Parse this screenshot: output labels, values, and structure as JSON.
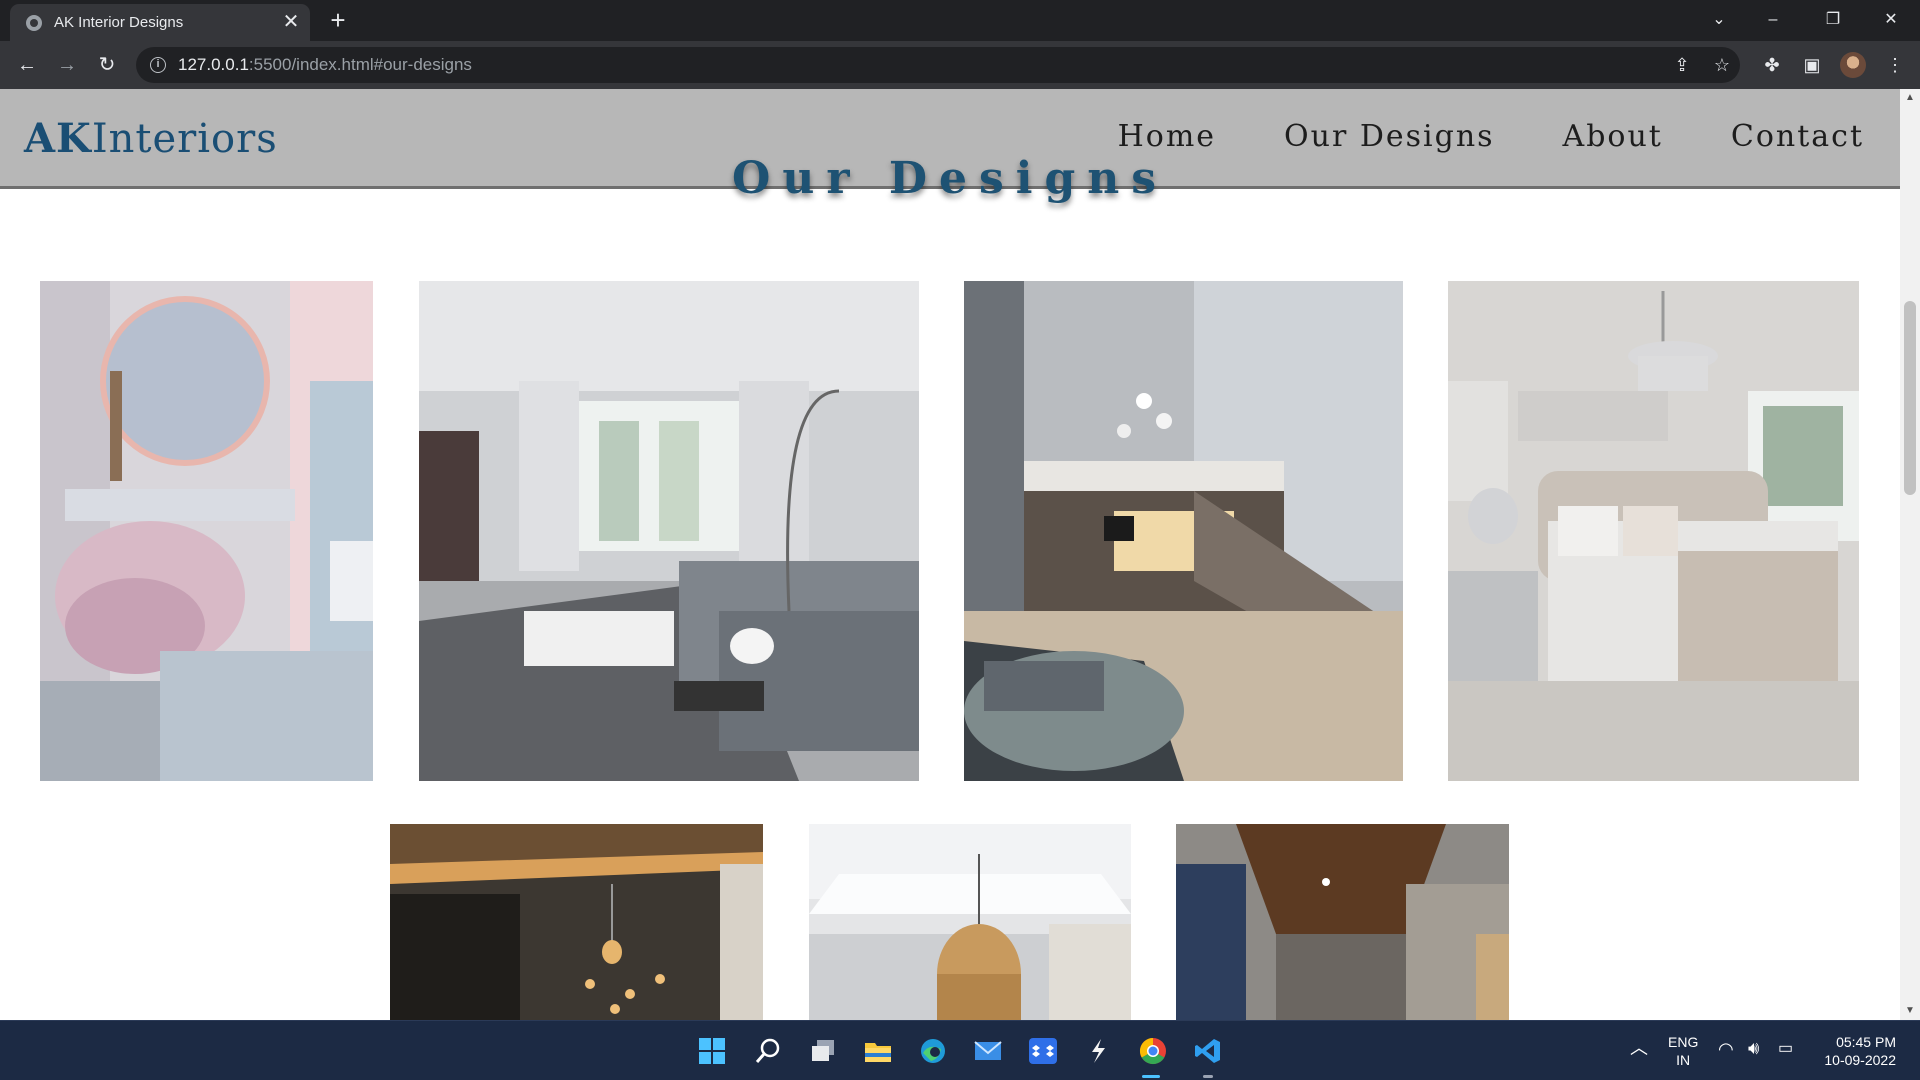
{
  "browser": {
    "tab_title": "AK Interior Designs",
    "tab_close": "✕",
    "new_tab": "+",
    "url_host": "127.0.0.1",
    "url_rest": ":5500/index.html#our-designs",
    "icons": [
      "back-arrow-icon",
      "forward-arrow-icon",
      "reload-icon",
      "info-icon",
      "share-icon",
      "star-icon",
      "extensions-icon",
      "side-panel-icon",
      "profile-avatar",
      "menu-kebab-icon"
    ]
  },
  "site": {
    "logo_bold": "AK",
    "logo_rest": "Interiors",
    "nav": [
      "Home",
      "Our Designs",
      "About",
      "Contact"
    ],
    "section_title": "Our Designs"
  },
  "gallery": {
    "row1": [
      "pink-vanity-room",
      "grey-living-room",
      "loft-living-room",
      "grey-bedroom"
    ],
    "row2": [
      "dark-lounge-pendant",
      "wood-pendant-ceiling",
      "wood-ceiling-corridor"
    ]
  },
  "taskbar": {
    "apps": [
      "windows-start-icon",
      "search-icon",
      "task-view-icon",
      "file-explorer-icon",
      "edge-icon",
      "mail-icon",
      "dropbox-icon",
      "arrow-app-icon",
      "chrome-icon",
      "vscode-icon"
    ],
    "lang_top": "ENG",
    "lang_bottom": "IN",
    "time": "05:45 PM",
    "date": "10-09-2022"
  },
  "colors": {
    "header_bg": "#b7b7b7",
    "logo": "#1a4e74",
    "title": "#1e5273",
    "taskbar": "#1c2a44"
  }
}
